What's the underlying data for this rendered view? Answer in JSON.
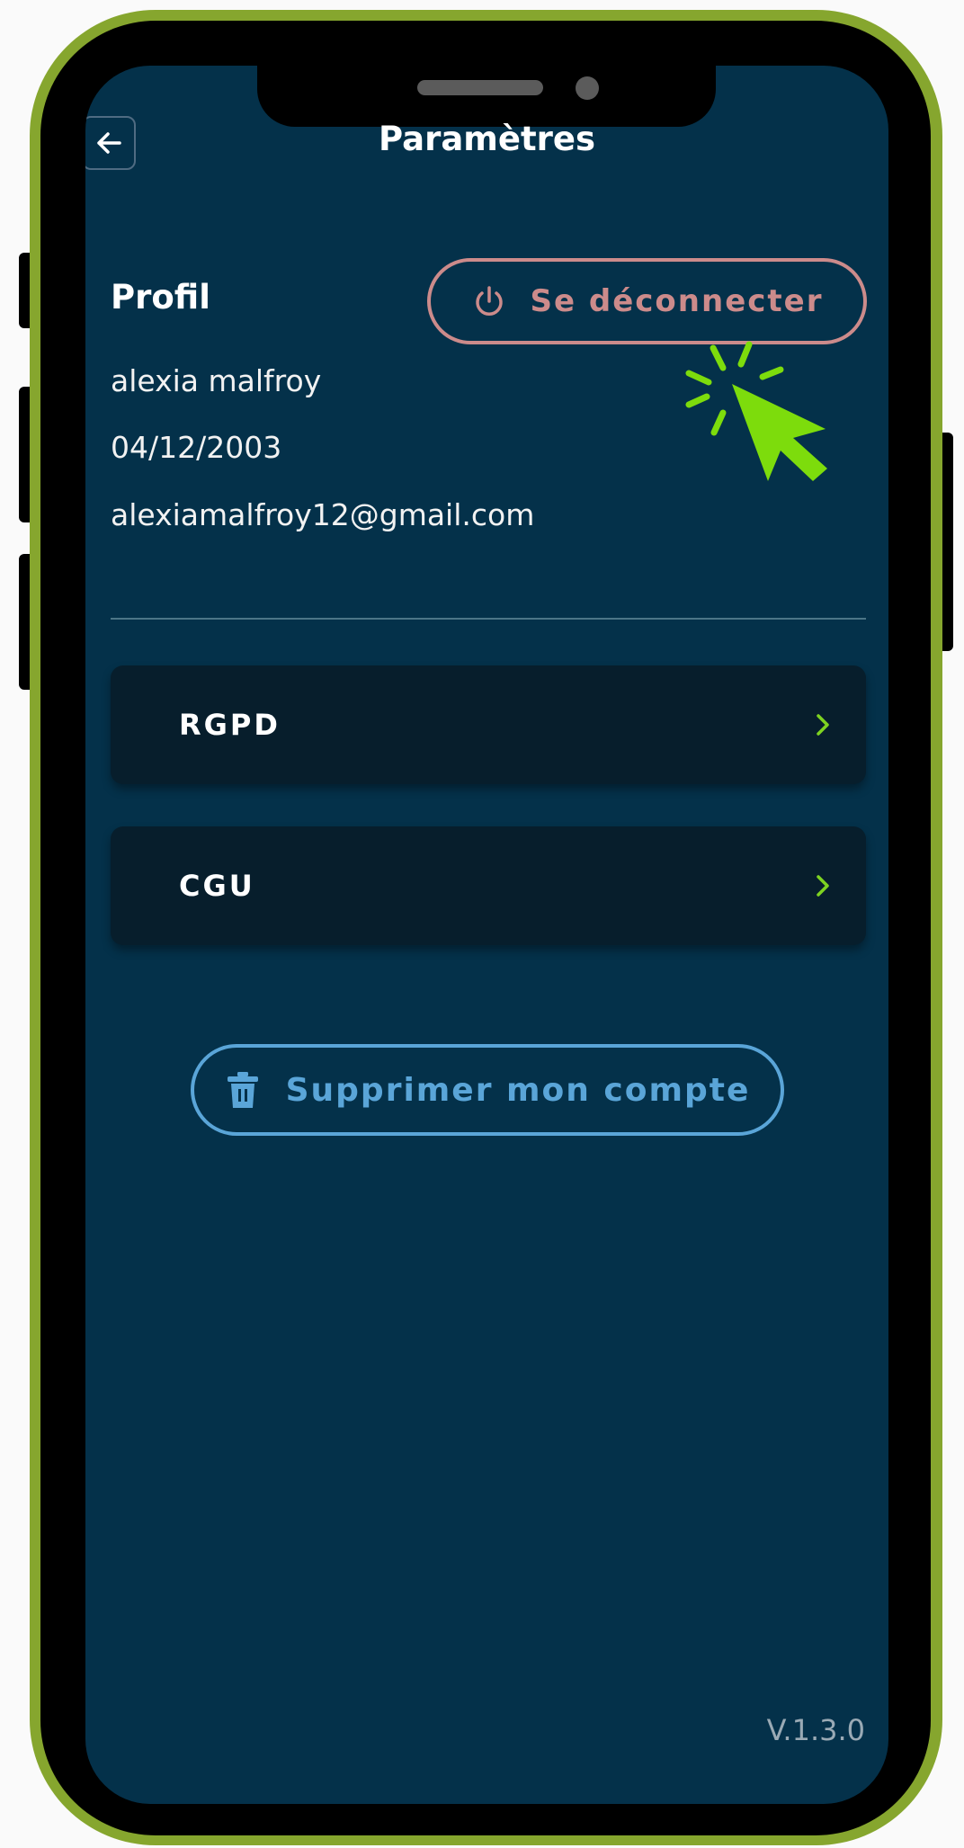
{
  "header": {
    "title": "Paramètres",
    "back_icon": "arrow-left-icon"
  },
  "profile": {
    "heading": "Profil",
    "name": "alexia malfroy",
    "birthdate": "04/12/2003",
    "email": "alexiamalfroy12@gmail.com",
    "logout_label": "Se déconnecter",
    "logout_icon": "power-icon"
  },
  "menu": {
    "items": [
      {
        "label": "RGPD",
        "icon": "chevron-right-icon"
      },
      {
        "label": "CGU",
        "icon": "chevron-right-icon"
      }
    ]
  },
  "danger": {
    "delete_label": "Supprimer mon compte",
    "delete_icon": "trash-icon"
  },
  "footer": {
    "version": "V.1.3.0"
  },
  "colors": {
    "frame": "#86a62e",
    "background": "#04314a",
    "card": "#071e2c",
    "logout": "#cc8b8b",
    "delete": "#5aa5d8",
    "chevron": "#7ed321",
    "cursor": "#7ddc0c"
  }
}
